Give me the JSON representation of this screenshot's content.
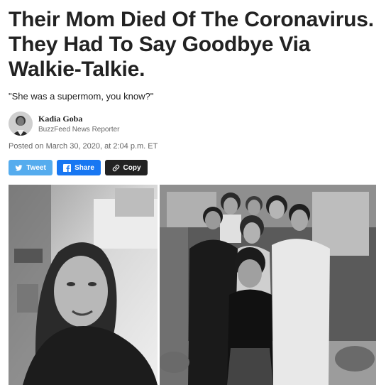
{
  "article": {
    "headline": "Their Mom Died Of The Coronavirus. They Had To Say Goodbye Via Walkie-Talkie.",
    "dek": "\"She was a supermom, you know?\"",
    "author": {
      "name": "Kadia Goba",
      "role": "BuzzFeed News Reporter"
    },
    "posted": "Posted on March 30, 2020, at 2:04 p.m. ET"
  },
  "share": {
    "tweet_label": "Tweet",
    "share_label": "Share",
    "copy_label": "Copy",
    "tweet_icon": "twitter-bird-icon",
    "share_icon": "facebook-icon",
    "copy_icon": "link-icon"
  },
  "colors": {
    "twitter": "#55acee",
    "facebook": "#1877f2",
    "copy": "#222222"
  },
  "images": [
    {
      "name": "mother-portrait-photo",
      "style": "black-and-white"
    },
    {
      "name": "family-group-photo",
      "style": "black-and-white"
    }
  ]
}
